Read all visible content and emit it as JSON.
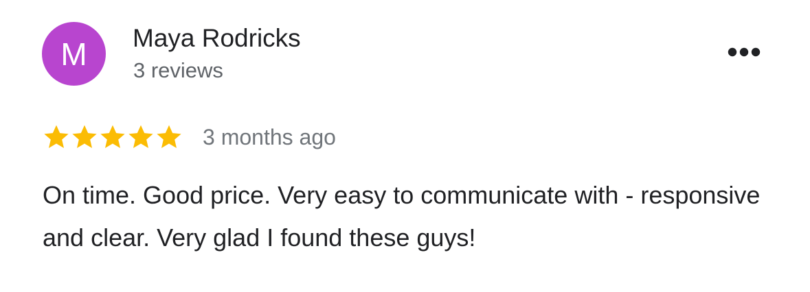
{
  "review": {
    "avatar_initial": "M",
    "avatar_color": "#b845cf",
    "author_name": "Maya Rodricks",
    "review_count": "3 reviews",
    "more_icon": "more-horizontal-icon",
    "rating": 5,
    "rating_max": 5,
    "star_color": "#fbbc04",
    "date": "3 months ago",
    "text": "On time. Good price. Very easy to communicate with - responsive and clear. Very glad I found these guys!"
  }
}
